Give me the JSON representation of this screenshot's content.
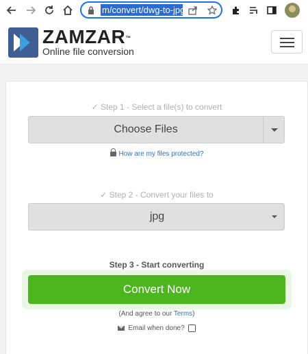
{
  "browser": {
    "url_text": "m/convert/dwg-to-jpg/",
    "icons": [
      "back-arrow-icon",
      "forward-arrow-icon",
      "reload-icon",
      "home-icon",
      "lock-icon",
      "share-icon",
      "bookmark-star-icon",
      "extensions-icon",
      "reading-list-icon",
      "sidebar-icon",
      "profile-avatar"
    ]
  },
  "header": {
    "brand": "ZAMZAR",
    "trademark": "™",
    "tagline": "Online file conversion",
    "menu_icon": "hamburger-icon"
  },
  "step1": {
    "label": "✓ Step 1 - Select a file(s) to convert",
    "button": "Choose Files",
    "protect_link": "How are my files protected?"
  },
  "step2": {
    "label": "✓ Step 2 - Convert your files to",
    "selected_format": "jpg"
  },
  "step3": {
    "label": "Step 3 - Start converting",
    "button": "Convert Now",
    "agree_prefix": "(And agree to our ",
    "terms_link": "Terms",
    "agree_suffix": ")",
    "email_label": "Email when done?",
    "email_checked": false
  },
  "colors": {
    "accent_green": "#4db51e",
    "link_blue": "#2a74c4",
    "brand_blue": "#3f5f94",
    "url_highlight": "#2b6cd4"
  }
}
